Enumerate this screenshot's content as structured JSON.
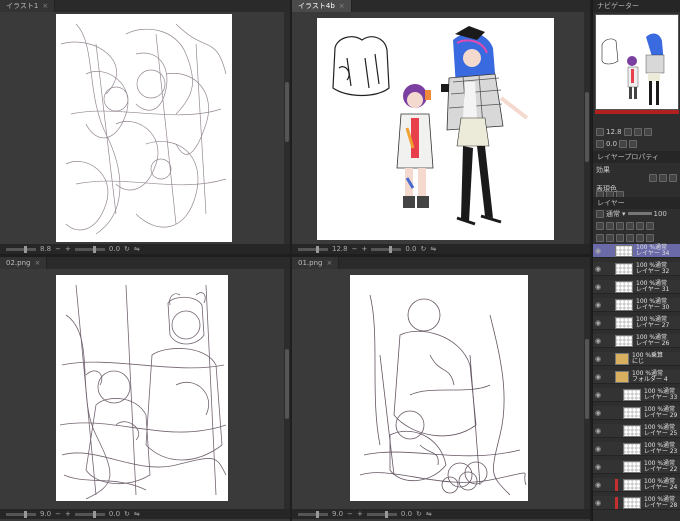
{
  "topbar": {
    "dot_icon": "●"
  },
  "panes": {
    "top_left": {
      "tab": "イラスト1",
      "zoom": "8.8",
      "angle": "0.0"
    },
    "top_right": {
      "tab": "イラスト4b",
      "zoom": "12.8",
      "angle": "0.0"
    },
    "bottom_left": {
      "tab": "02.png",
      "zoom": "9.0",
      "angle": "0.0"
    },
    "bottom_right": {
      "tab": "01.png",
      "zoom": "9.0",
      "angle": "0.0"
    }
  },
  "right_panel": {
    "navigator_tab": "ナビゲーター",
    "zoom_value": "12.8",
    "angle_value": "0.0",
    "layer_property_tab": "レイヤープロパティ",
    "effect_label": "効果",
    "expression_label": "表現色",
    "layer_tab": "レイヤー",
    "blend_mode": "通常",
    "opacity": "100",
    "layers": [
      {
        "line1": "100 %通常",
        "line2": "レイヤー 34",
        "selected": true
      },
      {
        "line1": "100 %通常",
        "line2": "レイヤー 32"
      },
      {
        "line1": "100 %通常",
        "line2": "レイヤー 31"
      },
      {
        "line1": "100 %通常",
        "line2": "レイヤー 30"
      },
      {
        "line1": "100 %通常",
        "line2": "レイヤー 27"
      },
      {
        "line1": "100 %通常",
        "line2": "レイヤー 26"
      },
      {
        "line1": "100 %乗算",
        "line2": "にじ",
        "folder": true
      },
      {
        "line1": "100 %通常",
        "line2": "フォルダー 4",
        "folder": true
      },
      {
        "line1": "100 %通常",
        "line2": "レイヤー 33",
        "sub": true
      },
      {
        "line1": "100 %通常",
        "line2": "レイヤー 29",
        "sub": true
      },
      {
        "line1": "100 %通常",
        "line2": "レイヤー 25",
        "sub": true
      },
      {
        "line1": "100 %通常",
        "line2": "レイヤー 23",
        "sub": true
      },
      {
        "line1": "100 %通常",
        "line2": "レイヤー 22",
        "sub": true
      },
      {
        "line1": "100 %通常",
        "line2": "レイヤー 24",
        "sub": true,
        "red": true
      },
      {
        "line1": "100 %通常",
        "line2": "レイヤー 28",
        "sub": true,
        "red": true
      }
    ]
  },
  "colors": {
    "background": "#1e1e1e",
    "pane": "#3a3a3a",
    "accent_selected": "#6a6aa8",
    "red_marker": "#c43030"
  }
}
